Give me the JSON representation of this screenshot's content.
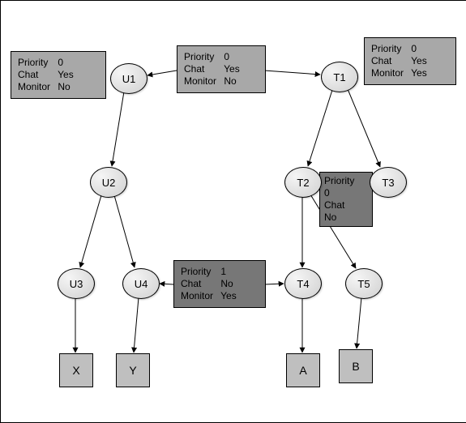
{
  "nodes": {
    "U1": "U1",
    "U2": "U2",
    "U3": "U3",
    "U4": "U4",
    "T1": "T1",
    "T2": "T2",
    "T3": "T3",
    "T4": "T4",
    "T5": "T5"
  },
  "leaves": {
    "X": "X",
    "Y": "Y",
    "A": "A",
    "B": "B"
  },
  "info": {
    "u1": {
      "l1a": "Priority",
      "l1b": "0",
      "l2a": "Chat",
      "l2b": "Yes",
      "l3a": "Monitor",
      "l3b": "No"
    },
    "root": {
      "l1a": "Priority",
      "l1b": "0",
      "l2a": "Chat",
      "l2b": "Yes",
      "l3a": "Monitor",
      "l3b": "No"
    },
    "t1": {
      "l1a": "Priority",
      "l1b": "0",
      "l2a": "Chat",
      "l2b": "Yes",
      "l3a": "Monitor",
      "l3b": "Yes"
    },
    "t2": {
      "l1a": "Priority",
      "l1b": "0",
      "l2a": "Chat",
      "l2b": "No"
    },
    "mid": {
      "l1a": "Priority",
      "l1b": "1",
      "l2a": "Chat",
      "l2b": "No",
      "l3a": "Monitor",
      "l3b": "Yes"
    }
  },
  "chart_data": {
    "type": "diagram",
    "title": "",
    "nodes": [
      {
        "id": "U1",
        "kind": "ellipse",
        "info": {
          "Priority": "0",
          "Chat": "Yes",
          "Monitor": "No"
        }
      },
      {
        "id": "U2",
        "kind": "ellipse"
      },
      {
        "id": "U3",
        "kind": "ellipse"
      },
      {
        "id": "U4",
        "kind": "ellipse",
        "info": {
          "Priority": "1",
          "Chat": "No",
          "Monitor": "Yes"
        }
      },
      {
        "id": "T1",
        "kind": "ellipse",
        "info": {
          "Priority": "0",
          "Chat": "Yes",
          "Monitor": "Yes"
        }
      },
      {
        "id": "T2",
        "kind": "ellipse",
        "info": {
          "Priority": "0",
          "Chat": "No"
        }
      },
      {
        "id": "T3",
        "kind": "ellipse"
      },
      {
        "id": "T4",
        "kind": "ellipse",
        "info": {
          "Priority": "1",
          "Chat": "No",
          "Monitor": "Yes"
        }
      },
      {
        "id": "T5",
        "kind": "ellipse"
      },
      {
        "id": "X",
        "kind": "box"
      },
      {
        "id": "Y",
        "kind": "box"
      },
      {
        "id": "A",
        "kind": "box"
      },
      {
        "id": "B",
        "kind": "box"
      }
    ],
    "edges": [
      [
        "ROOT",
        "U1"
      ],
      [
        "ROOT",
        "T1"
      ],
      [
        "U1",
        "U2"
      ],
      [
        "U2",
        "U3"
      ],
      [
        "U2",
        "U4"
      ],
      [
        "U3",
        "X"
      ],
      [
        "U4",
        "Y"
      ],
      [
        "T1",
        "T2"
      ],
      [
        "T1",
        "T3"
      ],
      [
        "T2",
        "T4"
      ],
      [
        "T2",
        "T5"
      ],
      [
        "T4",
        "A"
      ],
      [
        "T5",
        "B"
      ],
      [
        "MID",
        "U4"
      ],
      [
        "MID",
        "T4"
      ]
    ],
    "root_info": {
      "Priority": "0",
      "Chat": "Yes",
      "Monitor": "No"
    }
  }
}
